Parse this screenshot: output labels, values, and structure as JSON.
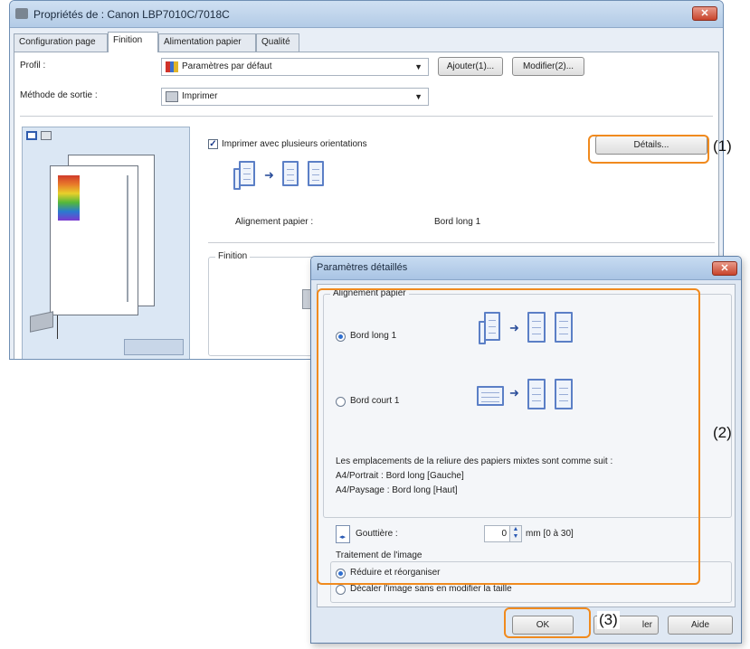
{
  "main_window": {
    "title": "Propriétés de : Canon LBP7010C/7018C",
    "close_glyph": "✕",
    "tabs": [
      "Configuration page",
      "Finition",
      "Alimentation papier",
      "Qualité"
    ],
    "active_tab": "Finition",
    "profile_label": "Profil :",
    "profile_value": "Paramètres par défaut",
    "add_button": "Ajouter(1)...",
    "modify_button": "Modifier(2)...",
    "output_label": "Méthode de sortie :",
    "output_value": "Imprimer",
    "checkbox_label": "Imprimer avec plusieurs orientations",
    "details_button": "Détails...",
    "alignment_label": "Alignement papier :",
    "alignment_value": "Bord long 1",
    "finition_group": "Finition"
  },
  "dialog": {
    "title": "Paramètres détaillés",
    "close_glyph": "✕",
    "alignment_group": "Alignement papier",
    "option_long": "Bord long 1",
    "option_short": "Bord court 1",
    "info_line1": "Les emplacements de la reliure des papiers mixtes sont comme suit :",
    "info_line2": "A4/Portrait : Bord long [Gauche]",
    "info_line3": "A4/Paysage : Bord long [Haut]",
    "gutter_label": "Gouttière :",
    "gutter_value": "0",
    "gutter_unit": "mm [0 à 30]",
    "image_group": "Traitement de l'image",
    "image_option1": "Réduire et réorganiser",
    "image_option2": "Décaler l'image sans en modifier la taille",
    "ok_button": "OK",
    "cancel_button_fragment": "ler",
    "help_button": "Aide"
  },
  "callouts": [
    "(1)",
    "(2)",
    "(3)"
  ],
  "colors": {
    "callout": "#f08a1e",
    "titlebar": "#b3cbe6",
    "accent": "#2f6fd0"
  }
}
